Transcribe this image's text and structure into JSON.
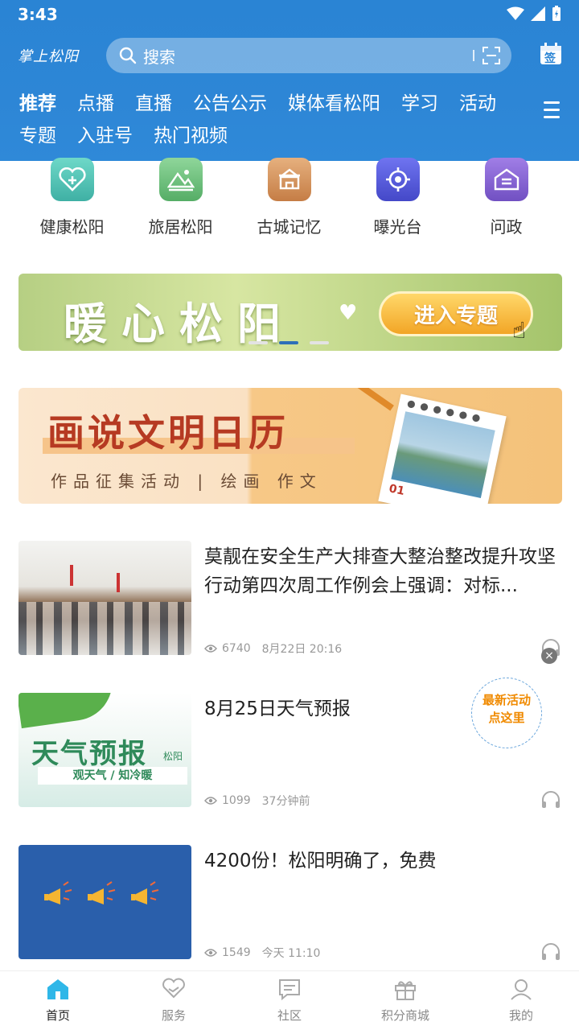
{
  "status": {
    "time": "3:43"
  },
  "header": {
    "brand": "掌上松阳",
    "search_placeholder": "搜索",
    "sign_label": "签",
    "tabs_row1": [
      "推荐",
      "点播",
      "直播",
      "公告公示",
      "媒体看松阳"
    ],
    "tabs_row2": [
      "学习",
      "活动",
      "专题",
      "入驻号",
      "热门视频"
    ]
  },
  "quick": [
    {
      "label": "健康松阳",
      "icon": "health-icon",
      "color": "#4fc2b5"
    },
    {
      "label": "旅居松阳",
      "icon": "mountain-icon",
      "color": "#6ec07a"
    },
    {
      "label": "古城记忆",
      "icon": "ancient-city-icon",
      "color": "#d49660"
    },
    {
      "label": "曝光台",
      "icon": "target-icon",
      "color": "#5a5fe0"
    },
    {
      "label": "问政",
      "icon": "house-icon",
      "color": "#8a63d6"
    }
  ],
  "banner1": {
    "title": "暖心松阳",
    "button": "进入专题"
  },
  "banner2": {
    "title": "画说文明日历",
    "subtitle": "作品征集活动 | 绘画 作文",
    "cal_num": "01"
  },
  "news": [
    {
      "title": "莫靓在安全生产大排查大整治整改提升攻坚行动第四次周工作例会上强调：对标...",
      "views": "6740",
      "time": "8月22日 20:16"
    },
    {
      "title": "8月25日天气预报",
      "views": "1099",
      "time": "37分钟前",
      "thumb_title": "天气预报",
      "thumb_tag": "松阳",
      "thumb_sub": "观天气 / 知冷暖"
    },
    {
      "title": "4200份！松阳明确了，免费",
      "views": "1549",
      "time": "今天 11:10"
    }
  ],
  "float": {
    "line1": "最新活动",
    "line2": "点这里",
    "close": "×"
  },
  "tabbar": [
    {
      "label": "首页",
      "icon": "home-icon"
    },
    {
      "label": "服务",
      "icon": "heart-hand-icon"
    },
    {
      "label": "社区",
      "icon": "chat-icon"
    },
    {
      "label": "积分商城",
      "icon": "gift-icon"
    },
    {
      "label": "我的",
      "icon": "user-icon"
    }
  ]
}
